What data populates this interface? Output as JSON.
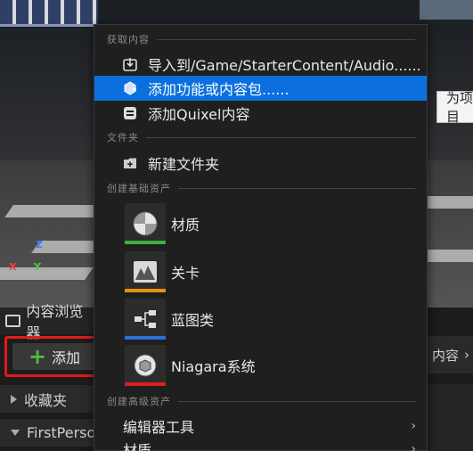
{
  "context_menu": {
    "sections": [
      {
        "title": "获取内容"
      },
      {
        "title": "文件夹"
      },
      {
        "title": "创建基础资产"
      },
      {
        "title": "创建高级资产"
      }
    ],
    "items": [
      {
        "label": "导入到/Game/StarterContent/Audio......",
        "icon": "import-icon"
      },
      {
        "label": "添加功能或内容包......",
        "icon": "feature-pack-icon",
        "highlighted": true
      },
      {
        "label": "添加Quixel内容",
        "icon": "quixel-icon"
      },
      {
        "label": "新建文件夹",
        "icon": "new-folder-icon"
      }
    ],
    "assets": [
      {
        "label": "材质",
        "icon": "material-icon",
        "color": "#3fae3f"
      },
      {
        "label": "关卡",
        "icon": "level-icon",
        "color": "#e8920e"
      },
      {
        "label": "蓝图类",
        "icon": "blueprint-icon",
        "color": "#2f6fd6"
      },
      {
        "label": "Niagara系统",
        "icon": "niagara-icon",
        "color": "#d82020"
      }
    ],
    "submenus": [
      {
        "label": "编辑器工具"
      },
      {
        "label": "材质"
      }
    ]
  },
  "content_browser": {
    "tab_label": "内容浏览器",
    "add_button_label": "添加",
    "favorites_label": "收藏夹",
    "project_label": "FirstPerso",
    "right_label": "内容"
  },
  "tooltip": {
    "text": "为项目"
  },
  "colors": {
    "highlight": "#0b6fde",
    "add_border": "#e01b1b",
    "plus": "#4cbd3b"
  }
}
